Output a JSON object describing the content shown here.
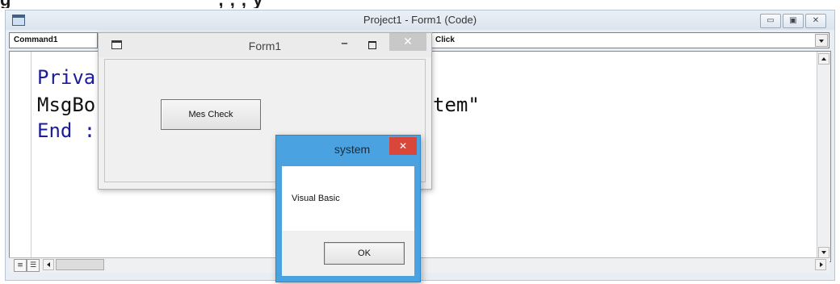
{
  "code_window": {
    "title": "Project1 - Form1 (Code)",
    "object_combo": "Command1",
    "procedure_combo": "Click",
    "code_lines": [
      {
        "text": "Priva",
        "kind": "keyword"
      },
      {
        "text": "MsgBo",
        "kind": "plain"
      },
      {
        "text": "tem\"",
        "kind": "plain"
      },
      {
        "text": "End :",
        "kind": "keyword"
      }
    ],
    "window_buttons": {
      "minimize_glyph": "▭",
      "maximize_glyph": "▣",
      "close_glyph": "✕"
    }
  },
  "form1": {
    "title": "Form1",
    "min_glyph": "–",
    "close_glyph": "✕",
    "button_label": "Mes Check"
  },
  "msgbox": {
    "title": "system",
    "message": "Visual Basic",
    "ok_label": "OK",
    "close_glyph": "✕"
  },
  "colors": {
    "keyword": "#1c1c9e",
    "msgbox_frame": "#4aa3e0",
    "close_red": "#d9473a"
  },
  "icons": [
    "app-icon",
    "form-icon",
    "procedure-view-icon",
    "full-module-view-icon"
  ]
}
